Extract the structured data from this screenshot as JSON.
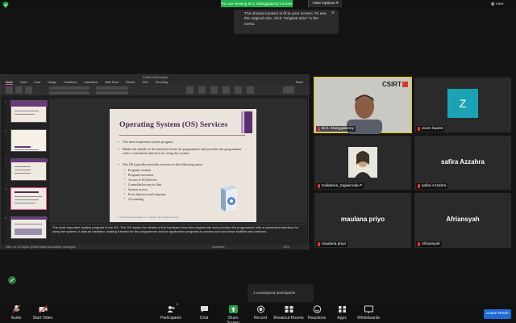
{
  "top_bar": {
    "share_banner": "You are viewing M.S. Manggalanny's screen",
    "view_options": "View Options",
    "view_button": "View"
  },
  "tooltip": {
    "text": "The shared content is fit to your screen. To see the original size, click \"Original Size\" in the menu."
  },
  "powerpoint": {
    "file_title": "CH08-CSA10e.pptx",
    "tabs": [
      "Home",
      "Insert",
      "Draw",
      "Design",
      "Transitions",
      "Animations",
      "Slide Show",
      "Review",
      "View",
      "Recording"
    ],
    "share_label": "Share",
    "status_text": "Slide 4 of 33    English (United States)    Accessibility: Investigate",
    "slide_numbers": [
      "1",
      "2",
      "3",
      "4",
      "5"
    ],
    "notes": "The most important system program is the OS. The OS masks the details of the hardware from the programmer and provides the programmer with a convenient interface for using the system. It acts as mediator, making it easier for the programmer and for application programs to access and use those facilities and services.",
    "comments_label": "Comments",
    "zoom": "100%"
  },
  "slide": {
    "title": "Operating System (OS) Services",
    "bullets": [
      "The most important system program",
      "Masks the details of the hardware from the programmer and provides the programmer with a convenient interface for using the system",
      "The OS typically provides services in the following areas:"
    ],
    "sub_bullets": [
      "Program creation",
      "Program execution",
      "Access to I/O devices",
      "Controlled access to files",
      "System access",
      "Error detection and response",
      "Accounting"
    ],
    "footer": "© 2016 Pearson Education, Inc., Hoboken, NJ. All rights reserved."
  },
  "participants_tiles": [
    {
      "name": "M.S. Manggalanny",
      "logo": "CSIRT"
    },
    {
      "name": "zoom baa04",
      "avatar": "Z"
    },
    {
      "name": "Kalideres_Sigiwimala P"
    },
    {
      "name": "safira Azzahra",
      "display": "safira Azzahra"
    },
    {
      "name": "maulana priyo",
      "display": "maulana priyo"
    },
    {
      "name": "Afriansyah",
      "display": "Afriansyah"
    }
  ],
  "unassigned": "3 unassigned participants",
  "toolbar": {
    "audio": "Audio",
    "video": "Start Video",
    "participants": "Participants",
    "participants_count": "6",
    "chat": "Chat",
    "share_screen": "Share Screen",
    "record": "Record",
    "breakout": "Breakout Rooms",
    "reactions": "Reactions",
    "apps": "Apps",
    "whiteboards": "Whiteboards",
    "leave": "Leave Room",
    "mute_badge": "1"
  },
  "colors": {
    "share_green": "#22b14c",
    "slide_purple": "#5b2f6e",
    "leave_blue": "#1e6bd6",
    "avatar_teal": "#1ba3b5"
  }
}
